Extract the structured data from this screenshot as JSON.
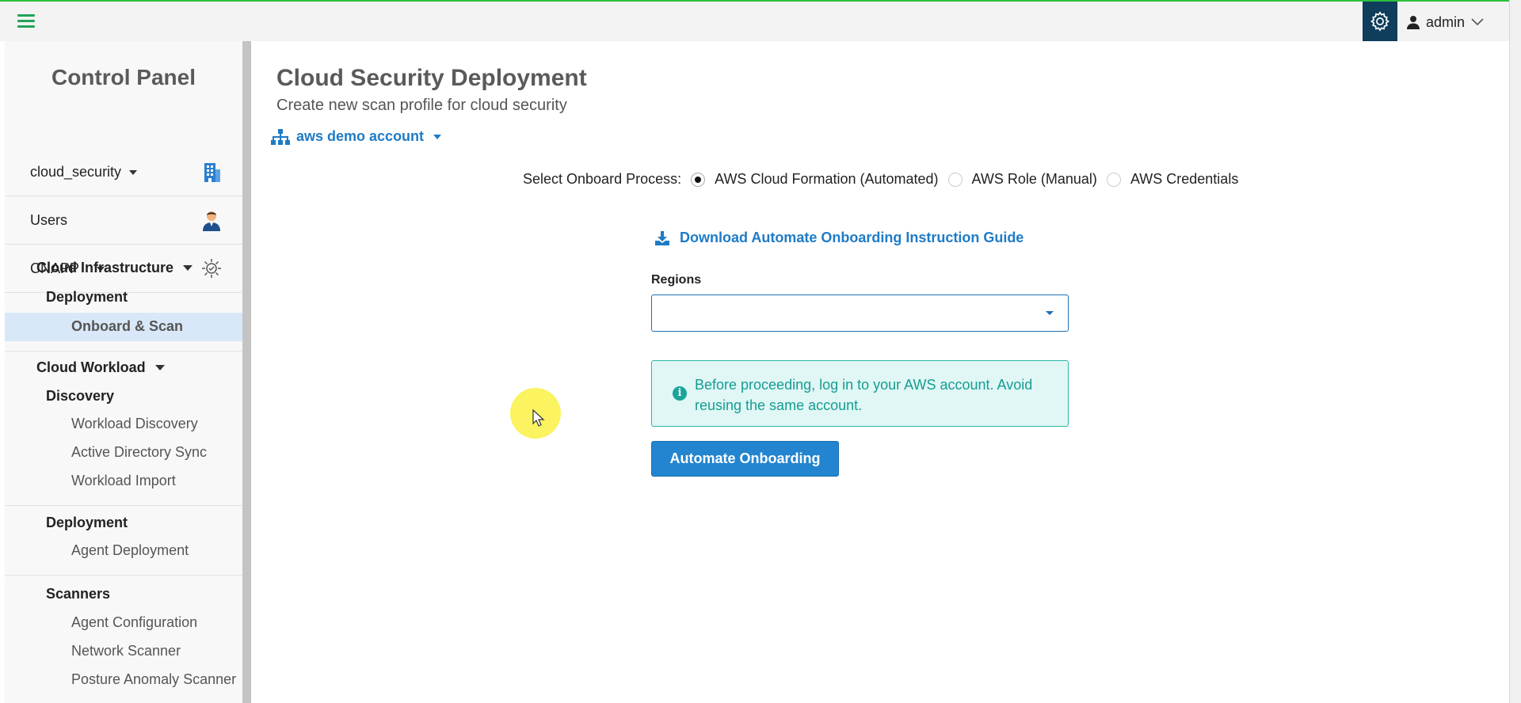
{
  "header": {
    "user_name": "admin"
  },
  "sidebar": {
    "title": "Control Panel",
    "tenant": "cloud_security",
    "users_label": "Users",
    "cnapp_label": "CNAPP",
    "cloud_infrastructure": {
      "label": "Cloud Infrastructure",
      "sub": "Deployment",
      "items": [
        "Onboard & Scan"
      ]
    },
    "cloud_workload": {
      "label": "Cloud Workload",
      "discovery": {
        "label": "Discovery",
        "items": [
          "Workload Discovery",
          "Active Directory Sync",
          "Workload Import"
        ]
      },
      "deployment": {
        "label": "Deployment",
        "items": [
          "Agent Deployment"
        ]
      },
      "scanners": {
        "label": "Scanners",
        "items": [
          "Agent Configuration",
          "Network Scanner",
          "Posture Anomaly Scanner"
        ]
      }
    }
  },
  "main": {
    "title": "Cloud Security Deployment",
    "subtitle": "Create new scan profile for cloud security",
    "account": "aws demo account",
    "onboard": {
      "label": "Select Onboard Process:",
      "options": [
        "AWS Cloud Formation (Automated)",
        "AWS Role (Manual)",
        "AWS Credentials"
      ],
      "selected": "AWS Cloud Formation (Automated)"
    },
    "download_link": "Download Automate Onboarding Instruction Guide",
    "regions_label": "Regions",
    "regions_value": "",
    "info_text": "Before proceeding, log in to your AWS account. Avoid reusing the same account.",
    "primary_button": "Automate Onboarding"
  },
  "colors": {
    "accent": "#2385d0",
    "link": "#1e7bc6",
    "info_bg": "#e0f7f5",
    "info_text": "#169c92",
    "top_border": "#2bbf3c",
    "gear_bg": "#0f3d5c"
  },
  "icons": [
    "menu-icon",
    "gear-icon",
    "user-icon",
    "chevron-down-icon",
    "building-icon",
    "user-avatar-icon",
    "cnapp-icon",
    "sitemap-icon",
    "download-icon",
    "info-icon"
  ]
}
